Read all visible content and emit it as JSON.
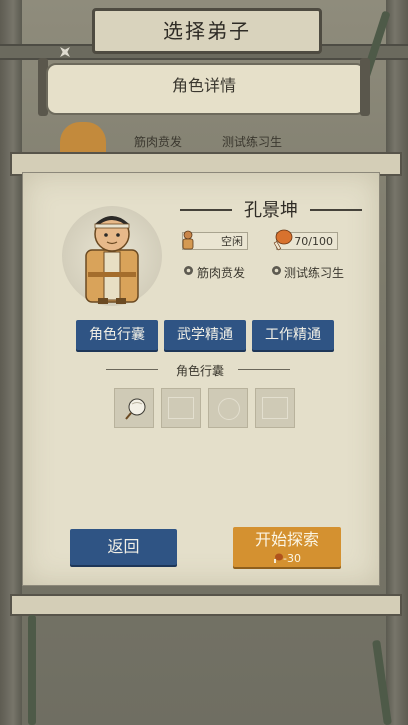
{
  "header": {
    "title": "选择弟子"
  },
  "scroll": {
    "title": "角色详情"
  },
  "background_traits": [
    "筋肉贲发",
    "测试练习生"
  ],
  "character": {
    "name": "孔景坤",
    "status": "空闲",
    "food": "70/100",
    "traits": [
      "筋肉贲发",
      "测试练习生"
    ]
  },
  "tabs": [
    "角色行囊",
    "武学精通",
    "工作精通"
  ],
  "inventory": {
    "label": "角色行囊",
    "slots": [
      "fan-item",
      "empty",
      "empty",
      "empty"
    ]
  },
  "actions": {
    "back": "返回",
    "start": "开始探索",
    "start_cost": "-30"
  },
  "colors": {
    "blue_button": "#2f5484",
    "orange_button": "#d49130",
    "panel": "#e4dfca"
  }
}
